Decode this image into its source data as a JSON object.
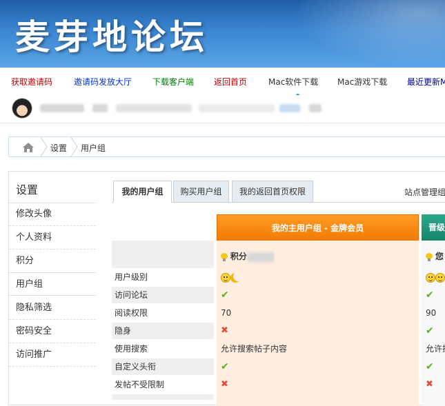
{
  "banner": {
    "title": "麦芽地论坛"
  },
  "nav": {
    "items": [
      {
        "label": "获取邀请码",
        "color": "#c00000"
      },
      {
        "label": "邀请码发放大厅",
        "color": "#0033cc"
      },
      {
        "label": "下载客户端",
        "color": "#008000"
      },
      {
        "label": "返回首页",
        "color": "#c00000"
      },
      {
        "label": "Mac软件下载",
        "color": "#333333"
      },
      {
        "label": "Mac游戏下载",
        "color": "#333333"
      },
      {
        "label": "最近更新M",
        "color": "#000099"
      }
    ]
  },
  "breadcrumb": {
    "items": [
      "设置",
      "用户组"
    ]
  },
  "sidebar": {
    "title": "设置",
    "items": [
      "修改头像",
      "个人资料",
      "积分",
      "用户组",
      "隐私筛选",
      "密码安全",
      "访问推广"
    ],
    "active": "用户组"
  },
  "tabs": {
    "items": [
      "我的用户组",
      "购买用户组",
      "我的返回首页权限"
    ],
    "active": "我的用户组",
    "right_link": "站点管理组"
  },
  "groups": {
    "main_header": "我的主用户组 - 金牌会员",
    "next_header": "晋级",
    "main_credit_label": "积分",
    "next_credit_label": "您"
  },
  "table": {
    "rows": [
      {
        "label": "用户级别",
        "main": "icons",
        "next": "icons"
      },
      {
        "label": "访问论坛",
        "main": "✔",
        "next": "✔"
      },
      {
        "label": "阅读权限",
        "main": "70",
        "next": "90"
      },
      {
        "label": "隐身",
        "main": "✖",
        "next": "✔"
      },
      {
        "label": "使用搜索",
        "main": "允许搜索帖子内容",
        "next": "允许搜"
      },
      {
        "label": "自定义头衔",
        "main": "✔",
        "next": "✔"
      },
      {
        "label": "发帖不受限制",
        "main": "✖",
        "next": "✖"
      }
    ]
  },
  "colors": {
    "banner": "#3b86d2",
    "main_group_header": "#f7870f",
    "next_group_header": "#1f9a7b",
    "check": "#5fae1c",
    "cross": "#e54b3a"
  }
}
